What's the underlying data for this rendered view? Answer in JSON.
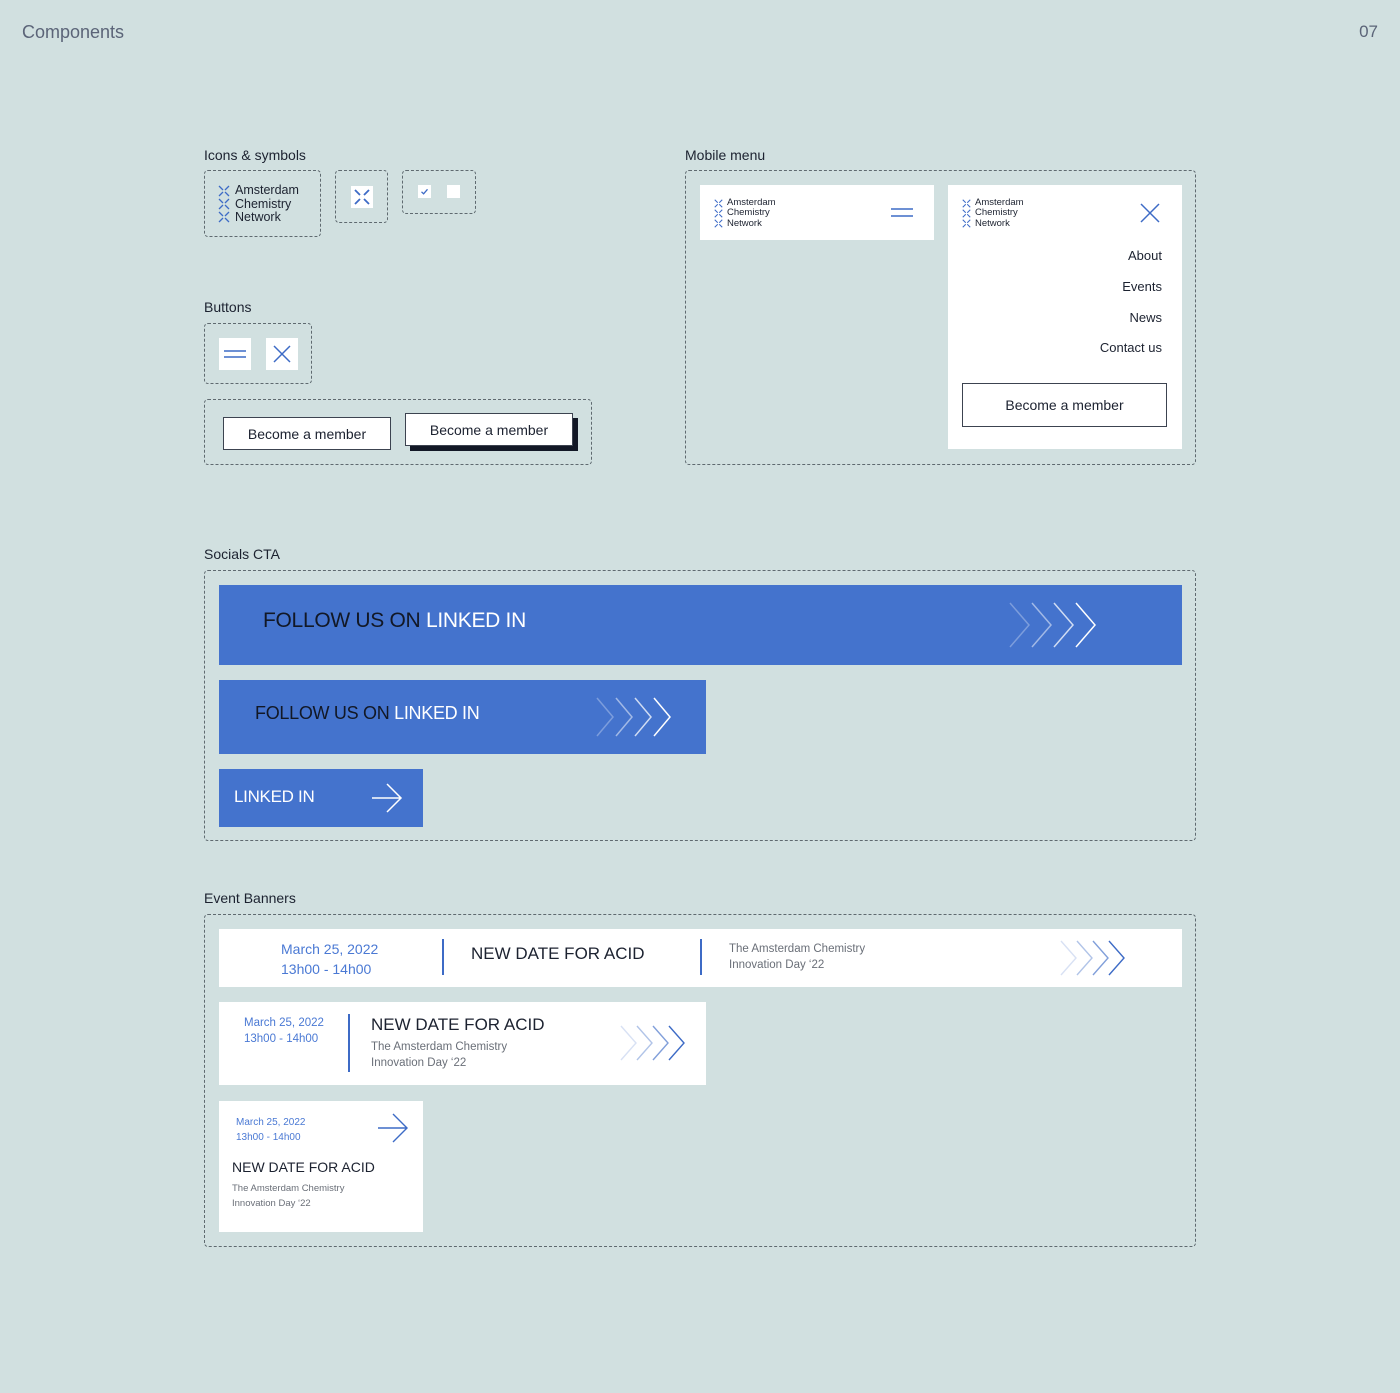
{
  "page": {
    "title": "Components",
    "number": "07"
  },
  "colors": {
    "background": "#d1e0e0",
    "brand_blue": "#4473cd",
    "ink": "#1c2230",
    "date_blue": "#4a79d4"
  },
  "logo": {
    "line1": "Amsterdam",
    "line2": "Chemistry",
    "line3": "Network",
    "icon": "x-mark-logo-icon"
  },
  "sections": {
    "icons": {
      "label": "Icons & symbols"
    },
    "buttons": {
      "label": "Buttons",
      "member_label": "Become a member",
      "member_label_shadow": "Become a member"
    },
    "mobile_menu": {
      "label": "Mobile menu",
      "items": [
        {
          "label": "About"
        },
        {
          "label": "Events"
        },
        {
          "label": "News"
        },
        {
          "label": "Contact us"
        }
      ],
      "cta": "Become a member"
    },
    "socials": {
      "label": "Socials CTA",
      "prefix": "FOLLOW US ON",
      "network": "LINKED IN"
    },
    "events": {
      "label": "Event Banners",
      "date": "March 25, 2022",
      "time": "13h00 - 14h00",
      "title": "NEW DATE FOR ACID",
      "subtitle_line1": "The Amsterdam Chemistry",
      "subtitle_line2": "Innovation Day ‘22"
    }
  }
}
